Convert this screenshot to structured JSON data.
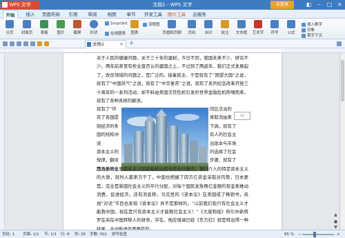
{
  "app": {
    "name": "WPS 文字",
    "window_title": "文档1 - WPS 文字",
    "login": "未登录"
  },
  "menu": {
    "tabs": [
      {
        "label": "开始",
        "active": true
      },
      {
        "label": "插入",
        "active": false
      },
      {
        "label": "页面布局",
        "active": false
      },
      {
        "label": "引用",
        "active": false
      },
      {
        "label": "审阅",
        "active": false
      },
      {
        "label": "视图",
        "active": false
      },
      {
        "label": "章节",
        "active": false
      },
      {
        "label": "开发工具",
        "active": false
      },
      {
        "label": "图片工具",
        "active": false
      },
      {
        "label": "云服务",
        "active": false
      }
    ]
  },
  "ribbon": {
    "buttons": [
      {
        "label": "分页",
        "icon": "page-break-icon",
        "color": "#4a7fc1"
      },
      {
        "label": "封面页",
        "icon": "cover-page-icon",
        "color": "#4a7fc1"
      },
      {
        "label": "表格",
        "icon": "table-icon",
        "color": "#3f8f5a"
      },
      {
        "label": "图片",
        "icon": "picture-icon",
        "color": "#4a9a4f"
      },
      {
        "label": "截屏",
        "icon": "screenshot-icon",
        "color": "#c0572e"
      },
      {
        "label": "形状",
        "icon": "shapes-icon",
        "color": "#4a7fc1"
      },
      {
        "label": "图表",
        "icon": "chart-icon",
        "color": "#d69a2b"
      },
      {
        "label": "页眉和页脚",
        "icon": "header-footer-icon",
        "color": "#4a7fc1"
      },
      {
        "label": "页码",
        "icon": "page-number-icon",
        "color": "#4a7fc1"
      },
      {
        "label": "水印",
        "icon": "watermark-icon",
        "color": "#4a7fc1"
      },
      {
        "label": "批注",
        "icon": "comment-icon",
        "color": "#d69a2b"
      },
      {
        "label": "文本框",
        "icon": "textbox-icon",
        "color": "#4a7fc1"
      },
      {
        "label": "艺术字",
        "icon": "wordart-icon",
        "color": "#c0392b"
      },
      {
        "label": "符号",
        "icon": "symbol-icon",
        "color": "#4a7fc1"
      },
      {
        "label": "公式",
        "icon": "formula-icon",
        "color": "#4a7fc1"
      }
    ],
    "small": {
      "smartart": "SmartArt",
      "online_chart": "在线图表",
      "flowchart": "流程图",
      "insert_number": "插入数字",
      "object": "对象",
      "first_letter": "首字下沉"
    }
  },
  "tab_bar": {
    "doc_tab": "文档1",
    "new_tab": "+"
  },
  "document": {
    "paragraph_top": "关于人民的健康问题，关于三十年的建树，今日不同，我国未来不少、研究不少。两年前甚至有些全盘否认的建国之上，不过到了两返年，我们正式发展起了，改良领域的问题之，是广泛的。接着民主、于是就有了“期望大国”之说，就有了“中国风气”之说，就有了“中华复苏”之说，就有了系列纪念改革开放三十周年的一系列活动，却不料由美国次贷危机引发的世界金融危机呼啸而来，就有了各种各样的解读。",
    "side_left": [
      "就有了“环",
      "有了各国提",
      "制经济的条",
      "国的结构冲突",
      "资本主义的",
      "规律，翻译",
      "其自由地化"
    ],
    "side_right": [
      "同比法治的",
      "来取消由来",
      "下调，就有了",
      "有人的社会主",
      "出现本与市场",
      "的选择了社会",
      "步骤，就有了"
    ],
    "paragraph_bottom": "国为新的主要资本主义国家纷纷出资与华全行救市。银行介入的特定资本主义的大款，就时人都来万千了。中国也把握了四方亿资金采取对内策，日本更是。完全是新国社会主义的平行分配，对每个国民发放两亿金额的现金来推动消费，促进经济。还有消息称，马克思的《资本论》在美国成了畅销书，央视“对话”节目也发现《资本论》并不是那样的，“以前我们现只有社会主义才能救中国，现在是只有资本主义才能救社会主义！”《大崖和纸》所引中新转罗在央在中国转移人的财务，学在，他应强调已经《东方红》就是特出得一种结果，主动能进不再要有的。"
  },
  "status": {
    "page": "页码: 1",
    "page_of": "页面: 1/1",
    "section": "节: 1/1",
    "line": "行: 8",
    "col": "列: 26",
    "word_count": "字数: 501",
    "spell": "拼写检查",
    "zoom": "85 %"
  },
  "colors": {
    "title_bar": "#3d7cc0",
    "wps_button": "#d94b32",
    "login_button": "#e8a23a",
    "accent": "#3d7cc0"
  }
}
